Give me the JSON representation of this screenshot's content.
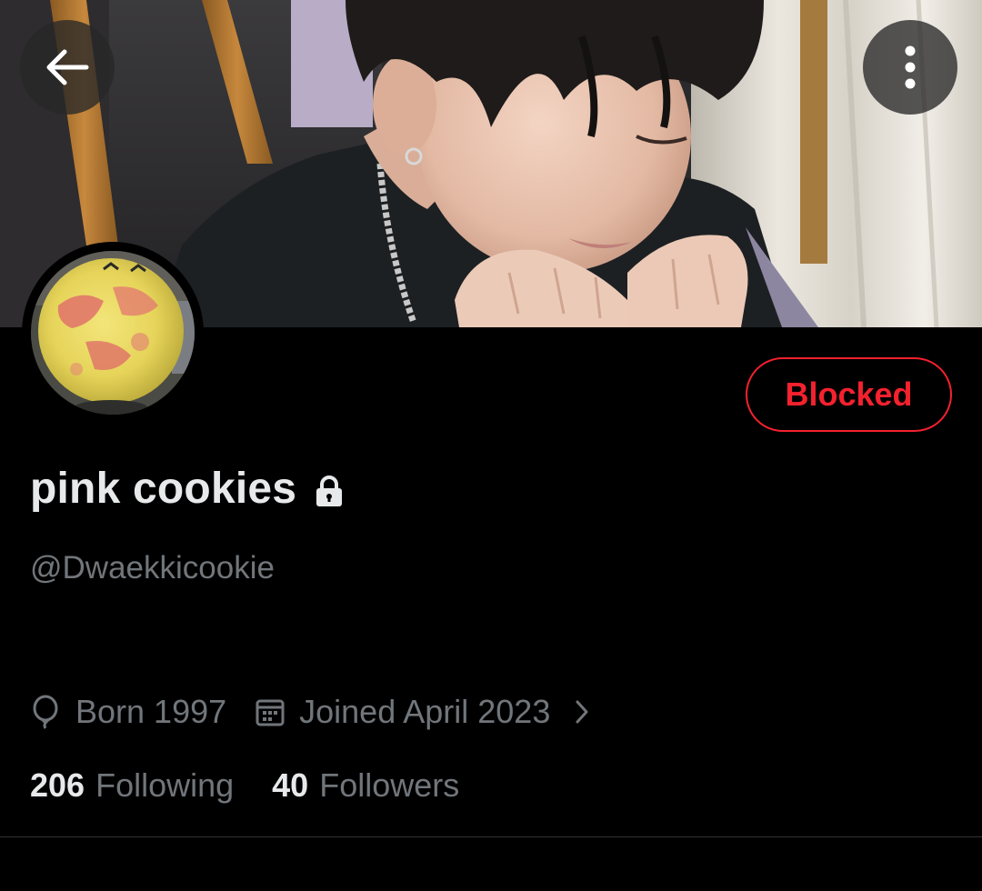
{
  "header": {
    "back_icon": "arrow-left-icon",
    "more_icon": "more-vertical-icon"
  },
  "profile": {
    "display_name": "pink cookies",
    "protected_icon": "lock-icon",
    "handle": "@Dwaekkicookie",
    "block_button_label": "Blocked",
    "birth_text": "Born 1997",
    "birth_icon": "balloon-icon",
    "joined_text": "Joined April 2023",
    "joined_icon": "calendar-icon",
    "joined_chevron_icon": "chevron-right-icon",
    "following_count": "206",
    "following_label": "Following",
    "followers_count": "40",
    "followers_label": "Followers"
  },
  "colors": {
    "background": "#000000",
    "primary_text": "#e7e9ea",
    "secondary_text": "#71767b",
    "blocked_red": "#f4212e",
    "divider": "#2f3336"
  }
}
